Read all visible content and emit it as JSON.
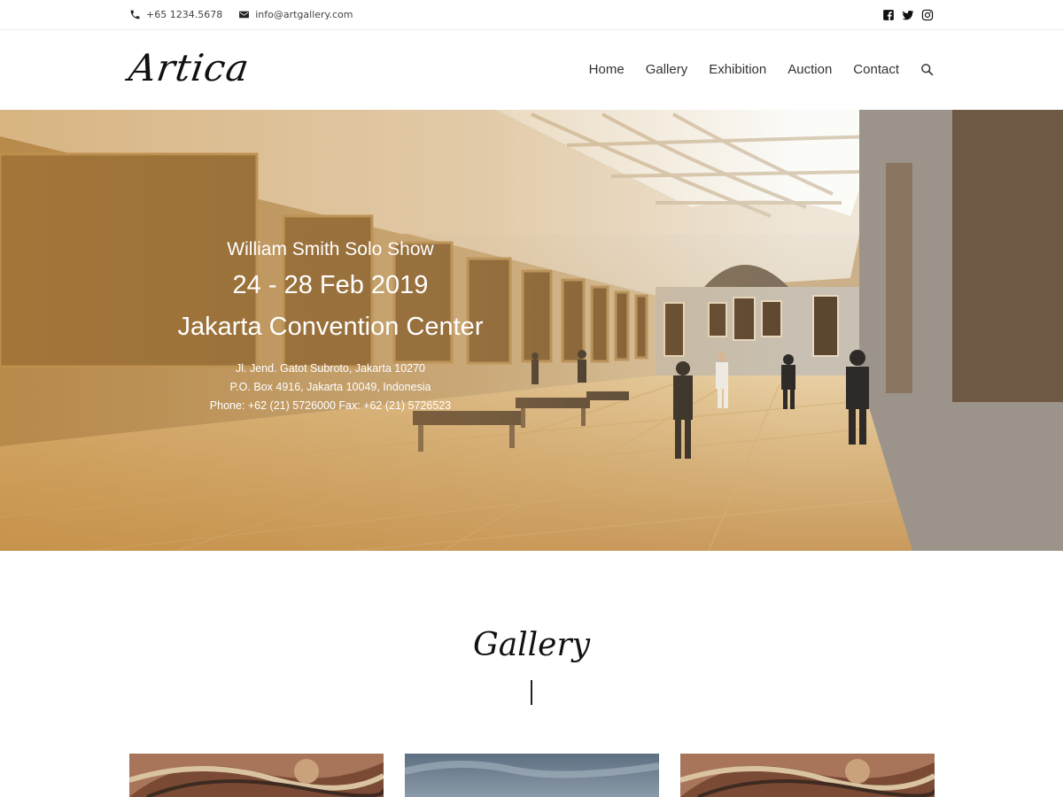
{
  "topbar": {
    "phone": "+65 1234.5678",
    "email": "info@artgallery.com",
    "social": [
      "facebook-icon",
      "twitter-icon",
      "instagram-icon"
    ]
  },
  "header": {
    "logo": "Artica",
    "nav": [
      "Home",
      "Gallery",
      "Exhibition",
      "Auction",
      "Contact"
    ]
  },
  "hero": {
    "show": "William Smith Solo Show",
    "date": "24 - 28 Feb 2019",
    "venue": "Jakarta Convention Center",
    "address_line1": "Jl. Jend. Gatot Subroto, Jakarta 10270",
    "address_line2": "P.O. Box 4916, Jakarta 10049, Indonesia",
    "address_line3": "Phone: +62 (21) 5726000 Fax: +62 (21) 5726523"
  },
  "gallery": {
    "title": "Gallery"
  },
  "colors": {
    "accent_overlay": "#c48c3c",
    "text_dark": "#111111"
  }
}
